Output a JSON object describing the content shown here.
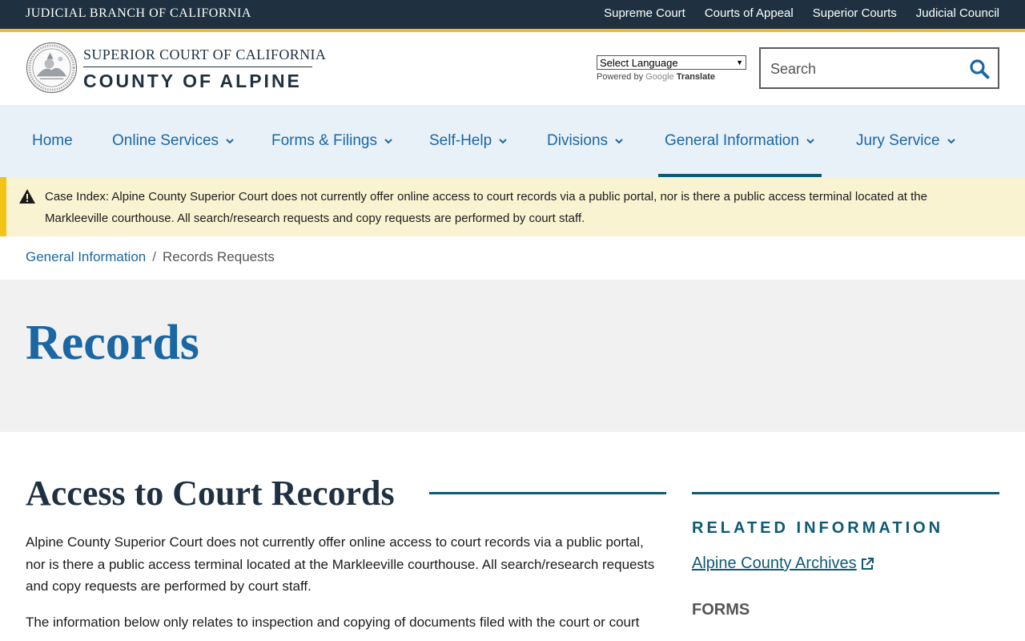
{
  "topbar": {
    "title": "JUDICIAL BRANCH OF CALIFORNIA",
    "links": [
      "Supreme Court",
      "Courts of Appeal",
      "Superior Courts",
      "Judicial Council"
    ]
  },
  "header": {
    "court_line1": "SUPERIOR COURT OF CALIFORNIA",
    "court_line2": "COUNTY OF ALPINE",
    "language_select": "Select Language",
    "powered_by": "Powered by",
    "powered_google": "Google",
    "powered_translate": "Translate",
    "search_placeholder": "Search"
  },
  "nav": {
    "items": [
      {
        "label": "Home",
        "dropdown": false
      },
      {
        "label": "Online Services",
        "dropdown": true
      },
      {
        "label": "Forms & Filings",
        "dropdown": true
      },
      {
        "label": "Self-Help",
        "dropdown": true
      },
      {
        "label": "Divisions",
        "dropdown": true
      },
      {
        "label": "General Information",
        "dropdown": true,
        "active": true
      },
      {
        "label": "Jury Service",
        "dropdown": true
      }
    ]
  },
  "alert": {
    "label": "Case Index:",
    "text": "Alpine County Superior Court does not currently offer online access to court records via a public portal, nor is there a public access terminal located at the Markleeville courthouse. All search/research requests and copy requests are performed by court staff."
  },
  "breadcrumb": {
    "parent": "General Information",
    "separator": "/",
    "current": "Records Requests"
  },
  "hero": {
    "title": "Records"
  },
  "main": {
    "section_title": "Access to Court Records",
    "para1": "Alpine County Superior Court does not currently offer online access to court records via a public portal, nor is there a public access terminal located at the Markleeville courthouse. All search/research requests and copy requests are performed by court staff.",
    "para2": "The information below only relates to inspection and copying of documents filed with the court or court"
  },
  "sidebar": {
    "heading": "RELATED INFORMATION",
    "link": "Alpine County Archives",
    "forms_heading": "FORMS"
  },
  "colors": {
    "topbar": "#1f3140",
    "gold": "#f2b82e",
    "link_blue": "#1a67a3",
    "teal": "#0e5a73",
    "nav_bg": "#e9f1f8",
    "alert_bg": "#faf3d1"
  }
}
